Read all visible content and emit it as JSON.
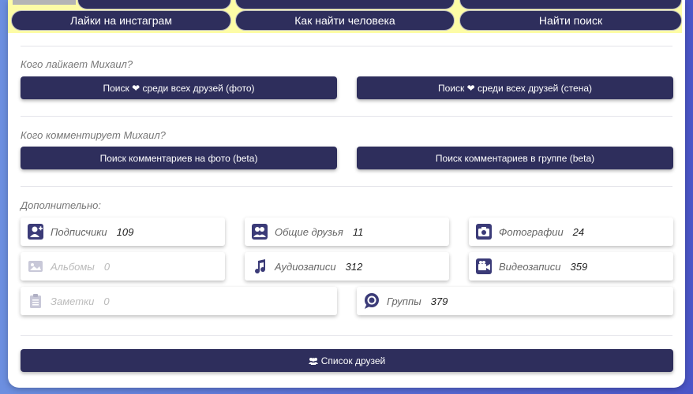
{
  "top_buttons": {
    "row1": [
      "",
      "",
      ""
    ],
    "row2": [
      "Лайки на инстаграм",
      "Как найти человека",
      "Найти поиск"
    ]
  },
  "likes_section": {
    "title": "Кого лайкает Михаил?",
    "btn_photo": "Поиск ❤ среди всех друзей (фото)",
    "btn_wall": "Поиск ❤ среди всех друзей (стена)"
  },
  "comments_section": {
    "title": "Кого комментирует Михаил?",
    "btn_photo": "Поиск комментариев на фото (beta)",
    "btn_group": "Поиск комментариев в группе (beta)"
  },
  "extra_section": {
    "title": "Дополнительно:",
    "stats": [
      {
        "label": "Подписчики",
        "value": "109",
        "icon": "add-user-icon"
      },
      {
        "label": "Общие друзья",
        "value": "11",
        "icon": "friends-icon"
      },
      {
        "label": "Фотографии",
        "value": "24",
        "icon": "camera-icon"
      },
      {
        "label": "Альбомы",
        "value": "0",
        "icon": "image-icon"
      },
      {
        "label": "Аудиозаписи",
        "value": "312",
        "icon": "music-note-icon"
      },
      {
        "label": "Видеозаписи",
        "value": "359",
        "icon": "video-camera-icon"
      },
      {
        "label": "Заметки",
        "value": "0",
        "icon": "clipboard-icon"
      },
      {
        "label": "Группы",
        "value": "379",
        "icon": "chat-bubble-icon"
      }
    ]
  },
  "friends_list_button": "Список друзей",
  "colors": {
    "button_bg": "#2e2e5c",
    "banner_bg": "#fdfca6"
  }
}
